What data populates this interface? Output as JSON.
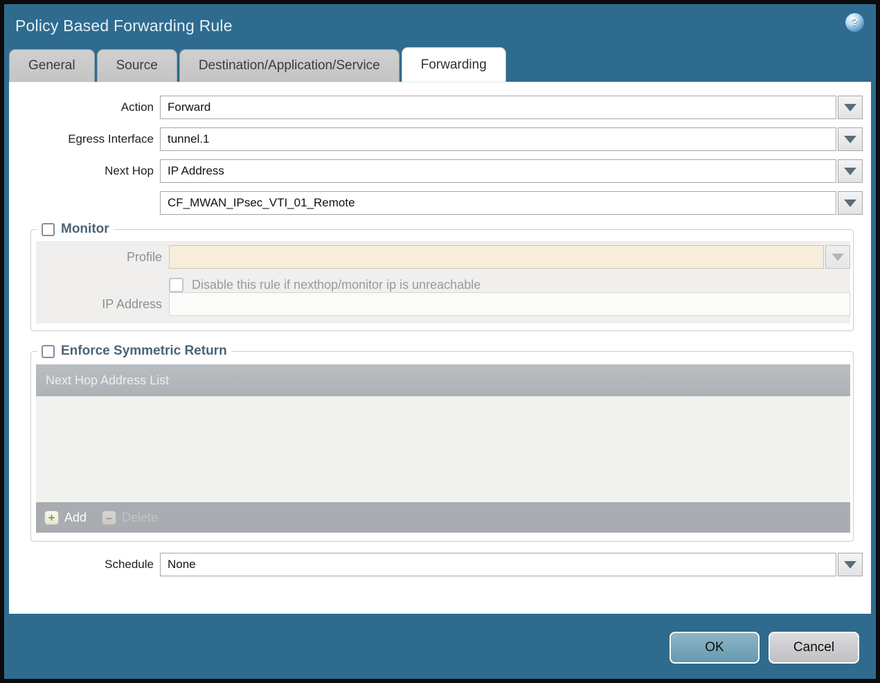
{
  "window": {
    "title": "Policy Based Forwarding Rule",
    "help_glyph": "?"
  },
  "tabs": [
    {
      "label": "General"
    },
    {
      "label": "Source"
    },
    {
      "label": "Destination/Application/Service"
    },
    {
      "label": "Forwarding"
    }
  ],
  "form": {
    "action": {
      "label": "Action",
      "value": "Forward"
    },
    "egress_interface": {
      "label": "Egress Interface",
      "value": "tunnel.1"
    },
    "next_hop": {
      "label": "Next Hop",
      "value": "IP Address"
    },
    "next_hop_address": {
      "value": "CF_MWAN_IPsec_VTI_01_Remote"
    },
    "schedule": {
      "label": "Schedule",
      "value": "None"
    }
  },
  "monitor": {
    "legend": "Monitor",
    "checked": false,
    "profile": {
      "label": "Profile",
      "value": ""
    },
    "disable_rule_label": "Disable this rule if nexthop/monitor ip is unreachable",
    "disable_rule_checked": false,
    "ip_address": {
      "label": "IP Address",
      "value": ""
    }
  },
  "enforce": {
    "legend": "Enforce Symmetric Return",
    "checked": false,
    "table_header": "Next Hop Address List",
    "rows": [],
    "add_label": "Add",
    "delete_label": "Delete"
  },
  "footer": {
    "ok": "OK",
    "cancel": "Cancel"
  },
  "colors": {
    "titlebar_teal": "#2e6b8e",
    "ok_button": "#6f9fb5",
    "disabled_field_beige": "#f6eedb",
    "table_header_gray": "#b3b7ba",
    "legend_text": "#4a6578"
  }
}
